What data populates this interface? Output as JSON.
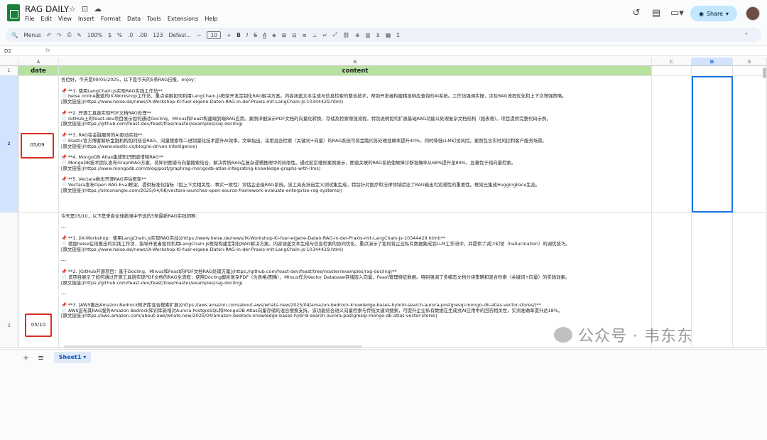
{
  "app": {
    "doc_title": "RAG DAILY",
    "menus": [
      "File",
      "Edit",
      "View",
      "Insert",
      "Format",
      "Data",
      "Tools",
      "Extensions",
      "Help"
    ],
    "share_label": "Share"
  },
  "toolbar": {
    "menus_label": "Menus",
    "zoom": "100%",
    "currency": "$",
    "percent": "%",
    "dec_less": ".0",
    "dec_more": ".00",
    "number_format": "123",
    "font": "Defaul...",
    "font_size": "10",
    "bold": "B",
    "italic": "I",
    "strike": "S",
    "text_color": "A"
  },
  "formula_bar": {
    "cell_ref": "D2",
    "fx": "fx"
  },
  "columns": [
    "A",
    "B",
    "C",
    "D",
    "E"
  ],
  "rows": [
    "1",
    "2",
    "3"
  ],
  "header": {
    "date": "date",
    "content": "content"
  },
  "row2": {
    "date": "05/09",
    "lines": [
      "各位好，今天是09/05/2025，以下是今天的5条RAG日报，enjoy：",
      "",
      "📌 **1. 使用LangChain.js实现RAG实践工作坊**",
      "📄 heise online报道的iX-Workshop工作坊，重点讲解如何利用LangChain.js框架开发定制化RAG解决方案。内容涵盖文本生成与信息检索的整合技术，帮助开发者构建精准响应查询的AI系统。工作坊强调实操，涉及RAG流程优化和上下文增强策略。",
      "[原文链接](https://www.heise.de/news/iX-Workshop-KI-fuer-eigene-Daten-RAG-in-der-Praxis-mit-LangChain-js-10344429.html)",
      "",
      "📌 **2. 开源工具链实现PDF文档RAG处理**",
      "📄 GitHub上的feast-dev项目展示如何通过Docling、Milvus和Feast构建端到端RAG应用。案例详细演示PDF文档的向量化转换、存储及检索增强流程，特别说明如何扩展基础RAG功能以处理复杂文档结构（如表格）。项目提供完整代码示例。",
      "[原文链接](https://github.com/feast-dev/feast/tree/master/examples/rag-docling)",
      "",
      "📌 **3. RAG在金融服务的AI驱动实践**",
      "📄 Elastic官方博客解析金融机构如何结合RAG、向量搜索和二进制量化技术提升AI效率。文章指出，采用混合检索（关键词+向量）的RAG系统可将金融问答处理准确率提升40%，同时降低LLM幻觉风险。案例包含实时风控和客户服务场景。",
      "[原文链接](https://www.elastic.co/blog/ai-driven-intelligence)",
      "",
      "📌 **4. MongoDB Atlas集成知识图谱增强RAG**",
      "📄 MongoDB技术团队发布GraphRAG方案，将知识图谱与向量搜索结合，解决传统RAG在复杂逻辑推理中的局限性。通过航空维修案例展示，图谱关联的RAG系统使故障诊断准确率从68%提升至89%，显著优于纯向量检索。",
      "[原文链接](https://www.mongodb.com/blog/post/graphrag-mongodb-atlas-integrating-knowledge-graphs-with-llms)",
      "",
      "📌 **5. Vectara推出开源RAG评估框架**",
      "📄 Vectara发布Open RAG Eval框架，提供标准化指标（如上下文相关性、事实一致性）评估企业级RAG系统。该工具支持自定义测试集生成，特别针对医疗和法律领域验证了RAG输出可追溯性的重要性。框架已集成HuggingFace生态。",
      "[原文链接](https://siliconangle.com/2025/04/08/vectara-launches-open-source-framework-evaluate-enterprise-rag-systems/)"
    ]
  },
  "row3": {
    "date": "05/10",
    "lines": [
      "今天是05/10，以下是来自全球新闻中节选的5条最新RAG实践洞察：",
      "",
      "---",
      "",
      "📌 **1. [iX-Workshop：使用LangChain.js实现RAG实战](https://www.heise.de/news/iX-Workshop-KI-fuer-eigene-Daten-RAG-in-der-Praxis-mit-LangChain-js-10344429.html)**",
      "📄 德国heise在线推出的实践工作坊，指导开发者如何利用LangChain.js框架构建定制化RAG解决方案。内容涵盖文本生成与信息检索的协同优化，重点演示了如何将企业私有数据集成到LLM工作流中，并提供了减少幻觉（hallucination）的调优技巧。",
      "[原文链接](https://www.heise.de/news/iX-Workshop-KI-fuer-eigene-Daten-RAG-in-der-Praxis-mit-LangChain-js-10344429.html)",
      "",
      "---",
      "",
      "📌 **2. [GitHub开源项目：基于Docling、Milvus和Feast的PDF文档RAG处理方案](https://github.com/feast-dev/feast/tree/master/examples/rag-docling)**",
      "📄 该项目展示了如何通过开源工具链实现PDF文档的RAG全流程：使用Docling解析复杂PDF（含表格/图像），Milvus作为Vector Database存储嵌入向量，Feast管理特征数据。特别强调了多模态文档分块策略和混合检索（关键词+向量）的实践效果。",
      "[原文链接](https://github.com/feast-dev/feast/tree/master/examples/rag-docling)",
      "",
      "---",
      "",
      "📌 **3. [AWS推出Amazon Bedrock知识库混合搜索扩展](https://aws.amazon.com/about-aws/whats-new/2025/04/amazon-bedrock-knowledge-bases-hybrid-search-aurora-postgresql-mongo-db-atlas-vector-stores/)**",
      "📄 AWS宣布其RAG服务Amazon Bedrock知识库新增对Aurora PostgreSQL和MongoDB Atlas向量存储的混合搜索支持。该功能结合语义向量检索与传统关键词搜索，可提升企业私有数据在生成式AI应用中的回答相关性，实测准确率提升达18%。",
      "[原文链接](https://aws.amazon.com/about-aws/whats-new/2025/04/amazon-bedrock-knowledge-bases-hybrid-search-aurora-postgresql-mongo-db-atlas-vector-stores)"
    ]
  },
  "sheet_tab": "Sheet1",
  "watermark": "公众号 · 韦东东"
}
